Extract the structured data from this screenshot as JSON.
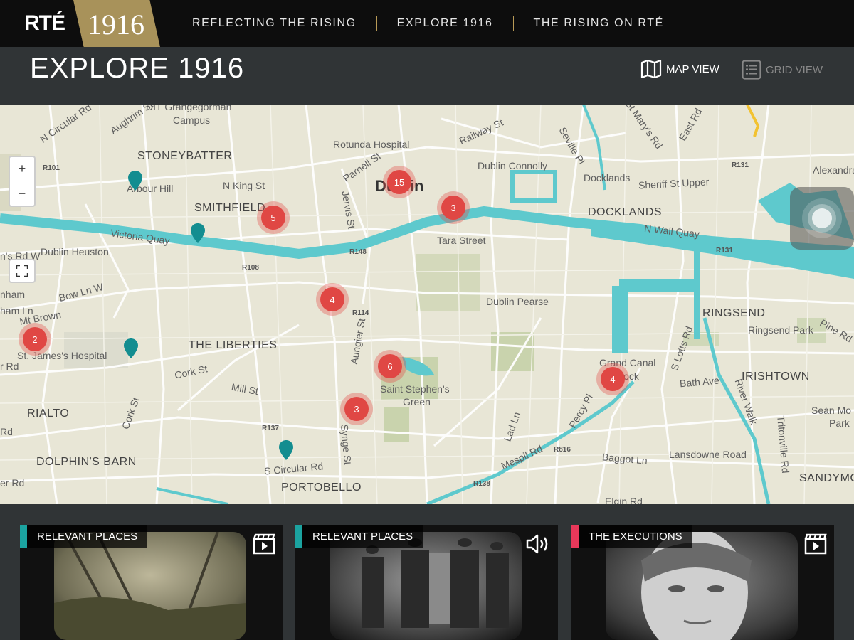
{
  "brand": {
    "logo_text": "RTÉ",
    "logo_year": "1916"
  },
  "nav": {
    "items": [
      "REFLECTING THE RISING",
      "EXPLORE 1916",
      "THE RISING ON RTÉ"
    ]
  },
  "header": {
    "title": "EXPLORE 1916",
    "map_view_label": "MAP VIEW",
    "grid_view_label": "GRID VIEW"
  },
  "map": {
    "zoom_in": "+",
    "zoom_out": "−",
    "fullscreen": "⛶",
    "labels": {
      "grangegorman": "DIT Grangegorman",
      "campus": "Campus",
      "aughrim": "Aughrim St",
      "ncircular": "N Circular Rd",
      "stoneybatter": "STONEYBATTER",
      "r101": "R101",
      "arbour": "Arbour Hill",
      "nking": "N King St",
      "smithfield": "SMITHFIELD",
      "victoria": "Victoria Quay",
      "heuston": "Dublin Heuston",
      "r108": "R108",
      "rotunda": "Rotunda Hospital",
      "parnell": "Parnell St",
      "railway": "Railway St",
      "connolly": "Dublin Connolly",
      "dublin": "Dublin",
      "jervis": "Jervis St",
      "tara": "Tara Street",
      "r148": "R148",
      "docklands_st": "Docklands",
      "sheriff": "Sheriff St Upper",
      "docklands": "DOCKLANDS",
      "nwall": "N Wall Quay",
      "r131a": "R131",
      "r131b": "R131",
      "alexandra": "Alexandra",
      "stmarys": "St Mary's Rd",
      "eastrd": "East Rd",
      "seville": "Seville Pl",
      "bowln": "Bow Ln W",
      "mtbrown": "Mt Brown",
      "stjames": "St. James's Hospital",
      "liberties": "THE LIBERTIES",
      "r114": "R114",
      "aungier": "Aungier St",
      "pearse": "Dublin Pearse",
      "ringsend": "RINGSEND",
      "ringsendpark": "Ringsend Park",
      "pinerd": "Pine Rd",
      "grandcanal": "Grand Canal",
      "dock": "Dock",
      "irishtown": "IRISHTOWN",
      "slotts": "S Lotts Rd",
      "bathave": "Bath Ave",
      "riverwalk": "River Walk",
      "stephens1": "Saint Stephen's",
      "stephens2": "Green",
      "corkst": "Cork St",
      "millst": "Mill St",
      "rialto": "RIALTO",
      "corkst2": "Cork St",
      "r137": "R137",
      "synge": "Synge St",
      "dolphin": "DOLPHIN'S BARN",
      "scircular": "S Circular Rd",
      "portobello": "PORTOBELLO",
      "ladln": "Lad Ln",
      "percypl": "Percy Pl",
      "mespil": "Mespil Rd",
      "r816": "R816",
      "baggot": "Baggot Ln",
      "lansdowne": "Lansdowne Road",
      "r138": "R138",
      "elgin": "Elgin Rd",
      "tritonville": "Tritonville Rd",
      "seanmoore1": "Seán Mo",
      "seanmoore2": "Park",
      "sandymount": "SANDYMO",
      "nham": "nham",
      "hamln": "ham Ln",
      "rdrd": "r Rd",
      "nrdw": "n's Rd W",
      "erdrd": "er Rd",
      "rdrd2": "Rd"
    },
    "clusters": [
      {
        "id": "c15",
        "count": "15"
      },
      {
        "id": "c3a",
        "count": "3"
      },
      {
        "id": "c5",
        "count": "5"
      },
      {
        "id": "c4a",
        "count": "4"
      },
      {
        "id": "c2",
        "count": "2"
      },
      {
        "id": "c6",
        "count": "6"
      },
      {
        "id": "c3b",
        "count": "3"
      },
      {
        "id": "c4b",
        "count": "4"
      }
    ]
  },
  "cards": [
    {
      "tag": "RELEVANT PLACES",
      "tag_color": "#1ba3a0",
      "media": "video-icon"
    },
    {
      "tag": "RELEVANT PLACES",
      "tag_color": "#1ba3a0",
      "media": "audio-icon"
    },
    {
      "tag": "THE EXECUTIONS",
      "tag_color": "#e8385a",
      "media": "video-icon"
    }
  ]
}
